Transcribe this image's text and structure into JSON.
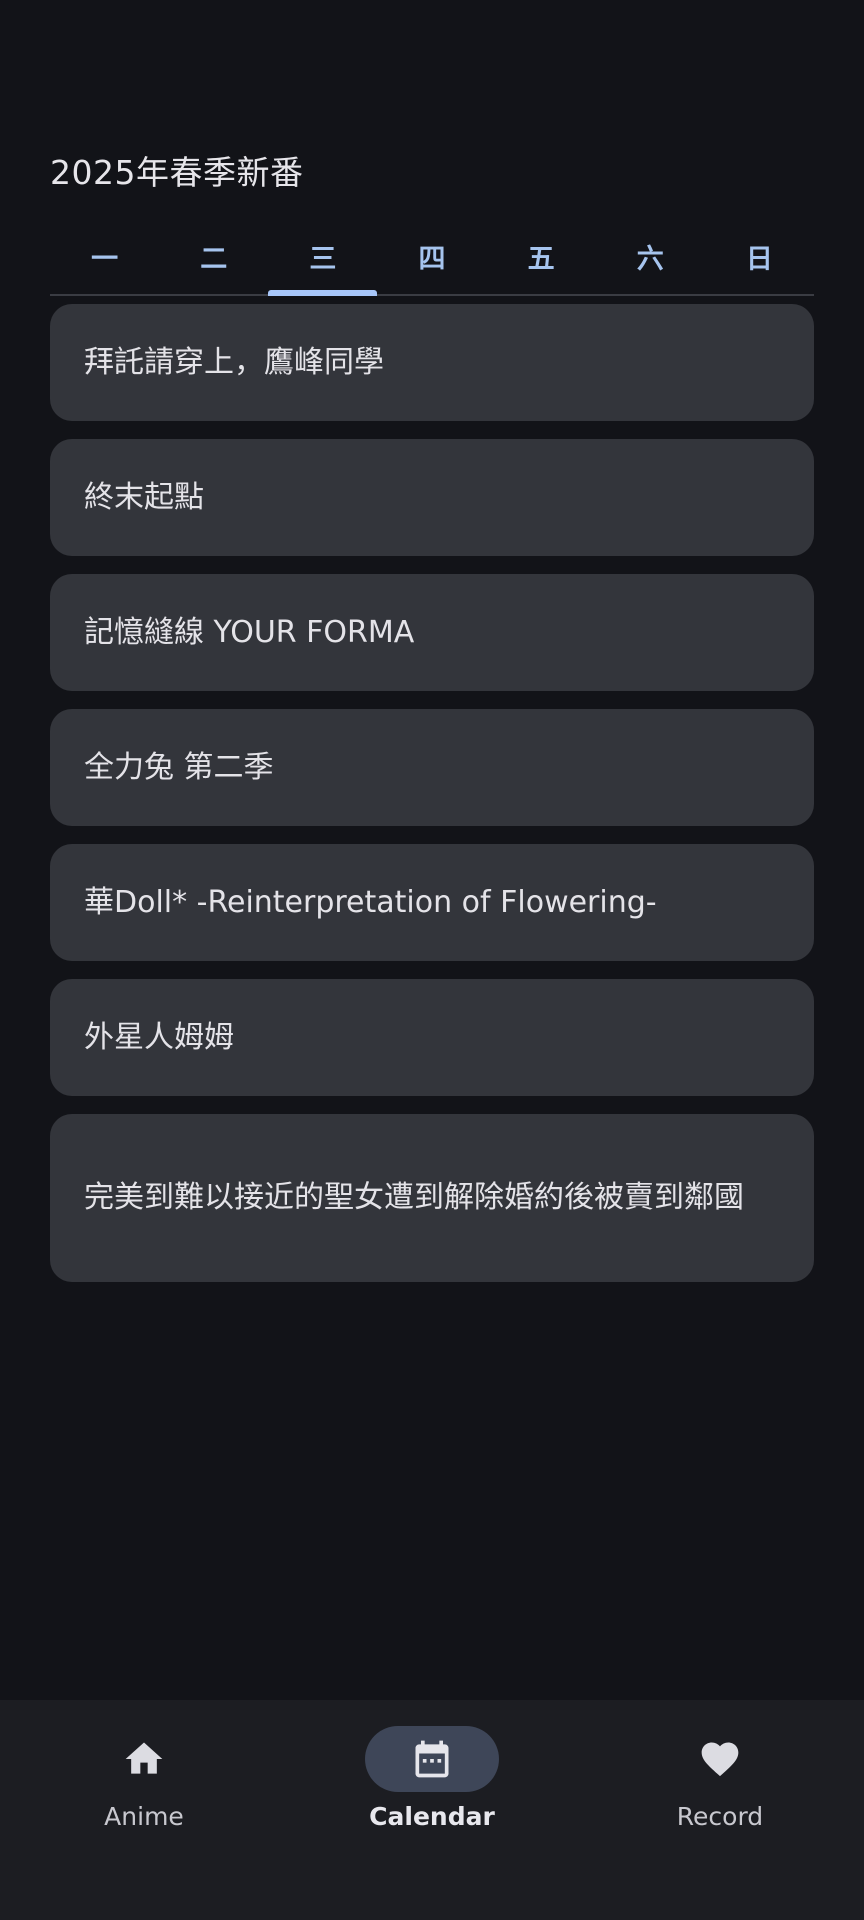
{
  "header": {
    "title": "2025年春季新番"
  },
  "tabs": [
    {
      "label": "一",
      "active": false
    },
    {
      "label": "二",
      "active": false
    },
    {
      "label": "三",
      "active": true
    },
    {
      "label": "四",
      "active": false
    },
    {
      "label": "五",
      "active": false
    },
    {
      "label": "六",
      "active": false
    },
    {
      "label": "日",
      "active": false
    }
  ],
  "anime_list": [
    "拜託請穿上，鷹峰同學",
    "終末起點",
    "記憶縫線 YOUR FORMA",
    "全力兔 第二季",
    "華Doll* -Reinterpretation of Flowering-",
    "外星人姆姆",
    "完美到難以接近的聖女遭到解除婚約後被賣到鄰國"
  ],
  "bottom_nav": {
    "items": [
      {
        "label": "Anime",
        "icon": "home-icon",
        "active": false
      },
      {
        "label": "Calendar",
        "icon": "calendar-icon",
        "active": true
      },
      {
        "label": "Record",
        "icon": "heart-icon",
        "active": false
      }
    ]
  },
  "colors": {
    "background": "#121318",
    "card": "#33353b",
    "tab_text": "#a6c4ee",
    "tab_indicator": "#a8c7fa",
    "nav_background": "#1c1d22",
    "nav_active_pill": "#3e4658"
  }
}
